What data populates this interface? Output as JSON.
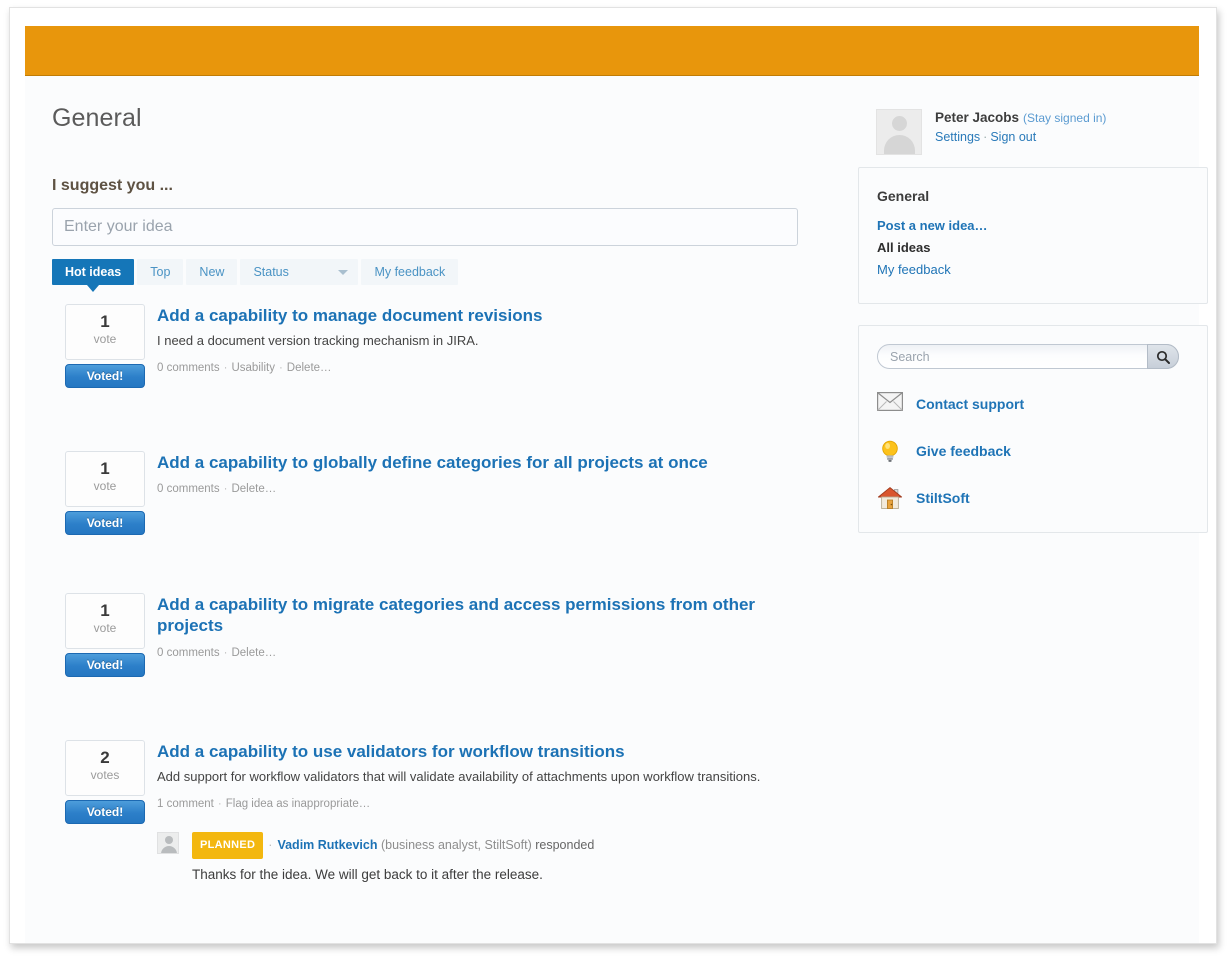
{
  "brand": {
    "bar_color": "#e8960c",
    "accent_blue": "#1c72b5",
    "status_yellow": "#f3b70f"
  },
  "page": {
    "title": "General"
  },
  "suggest": {
    "label": "I suggest you ...",
    "input_placeholder": "Enter your idea",
    "input_value": ""
  },
  "tabs": [
    {
      "label": "Hot ideas",
      "active": true
    },
    {
      "label": "Top",
      "active": false
    },
    {
      "label": "New",
      "active": false
    },
    {
      "label": "Status",
      "active": false,
      "type": "select"
    },
    {
      "label": "My feedback",
      "active": false
    }
  ],
  "ideas": [
    {
      "votes": "1",
      "votes_unit": "vote",
      "voted_label": "Voted!",
      "title": "Add a capability to manage document revisions",
      "description": "I need a document version tracking mechanism in JIRA.",
      "comments": "0 comments",
      "category": "Usability",
      "delete": "Delete…"
    },
    {
      "votes": "1",
      "votes_unit": "vote",
      "voted_label": "Voted!",
      "title": "Add a capability to globally define categories for all projects at once",
      "description": "",
      "comments": "0 comments",
      "category": "",
      "delete": "Delete…"
    },
    {
      "votes": "1",
      "votes_unit": "vote",
      "voted_label": "Voted!",
      "title": "Add a capability to migrate categories and access permissions from other projects",
      "description": "",
      "comments": "0 comments",
      "category": "",
      "delete": "Delete…"
    },
    {
      "votes": "2",
      "votes_unit": "votes",
      "voted_label": "Voted!",
      "title": "Add a capability to use validators for workflow transitions",
      "description": "Add support for workflow validators that will validate availability of attachments upon workflow transitions.",
      "comments": "1 comment",
      "category": "",
      "delete": "Flag idea as inappropriate…",
      "response": {
        "status": "PLANNED",
        "author": "Vadim Rutkevich",
        "role": "(business analyst, StiltSoft)",
        "verb": "responded",
        "body": "Thanks for the idea. We will get back to it after the release."
      }
    }
  ],
  "user": {
    "name": "Peter Jacobs",
    "stay_signed_in": "(Stay signed in)",
    "settings": "Settings",
    "sign_out": "Sign out",
    "avatar_icon": "user-avatar-icon"
  },
  "nav_panel": {
    "title": "General",
    "items": [
      {
        "label": "Post a new idea…",
        "style": "strong-link"
      },
      {
        "label": "All ideas",
        "style": "bold"
      },
      {
        "label": "My feedback",
        "style": "link"
      }
    ]
  },
  "support_panel": {
    "search_placeholder": "Search",
    "search_value": "",
    "search_icon": "magnifier-icon",
    "links": [
      {
        "label": "Contact support",
        "icon": "envelope-icon"
      },
      {
        "label": "Give feedback",
        "icon": "lightbulb-icon"
      },
      {
        "label": "StiltSoft",
        "icon": "house-icon"
      }
    ]
  }
}
